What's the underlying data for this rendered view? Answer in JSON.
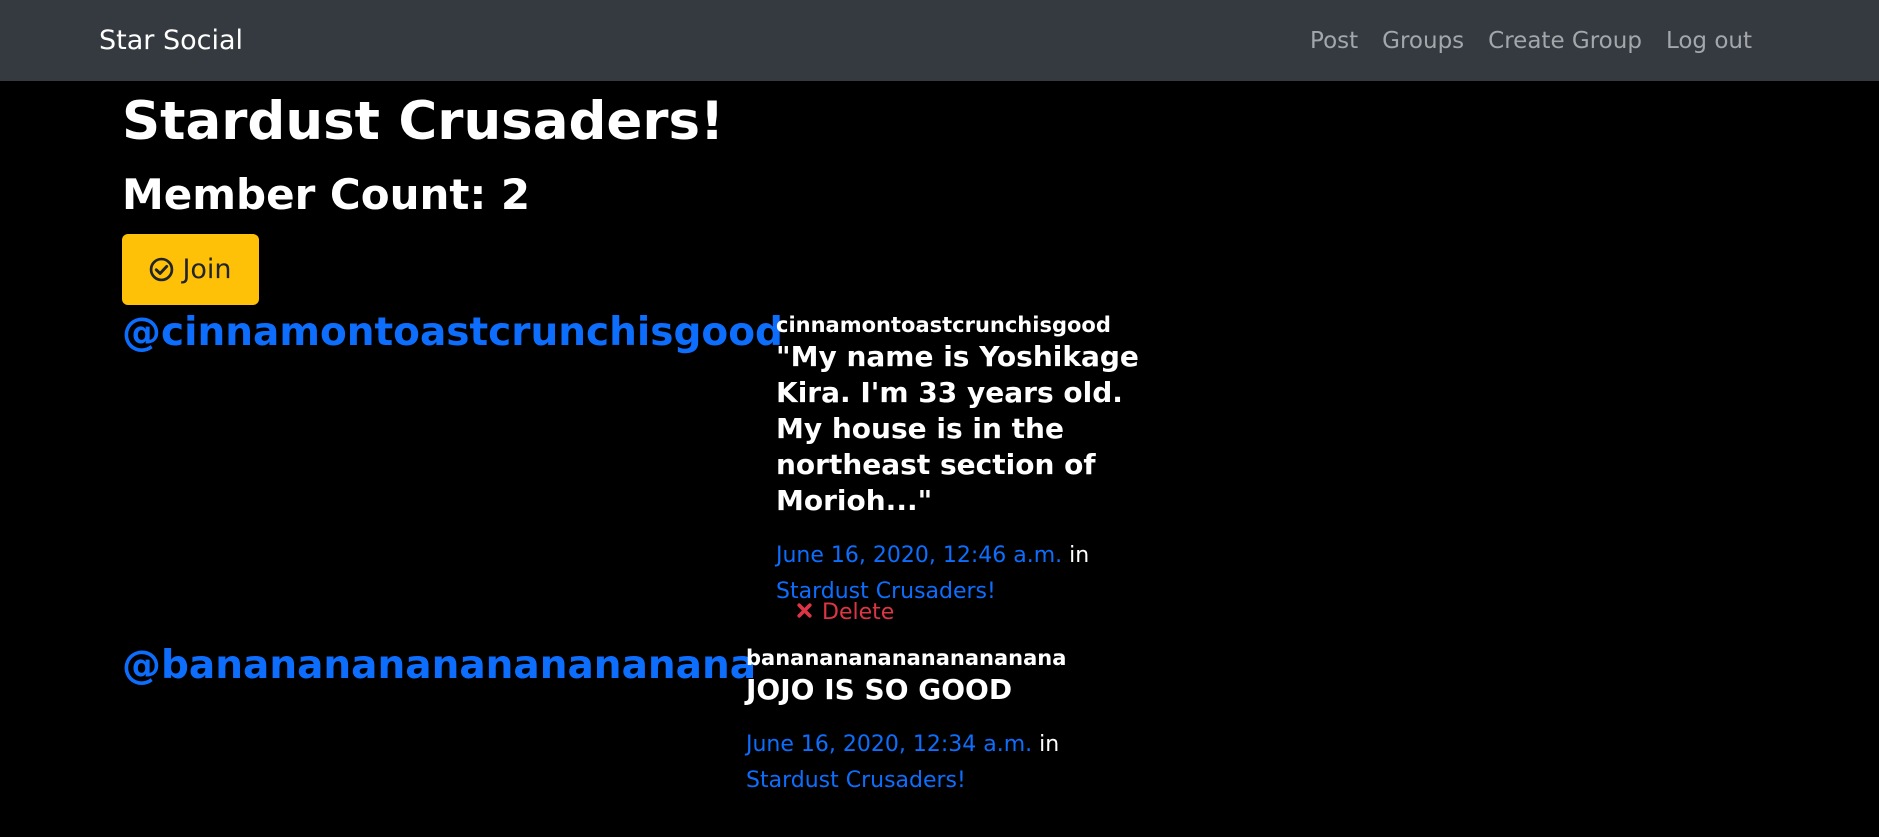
{
  "navbar": {
    "brand": "Star Social",
    "links": [
      "Post",
      "Groups",
      "Create Group",
      "Log out"
    ]
  },
  "group": {
    "title": "Stardust Crusaders!",
    "member_count": "Member Count: 2",
    "join_label": "Join"
  },
  "posts": [
    {
      "user_handle": "@cinnamontoastcrunchisgood",
      "author": "cinnamontoastcrunchisgood",
      "message": "\"My name is Yoshikage Kira. I'm 33 years old. My house is in the northeast section of Morioh...\"",
      "timestamp": "June 16, 2020, 12:46 a.m.",
      "in_word": " in ",
      "group": "Stardust Crusaders!",
      "delete_label": "Delete"
    },
    {
      "user_handle": "@banananananananananana",
      "author": "banananananananananana",
      "message": "JOJO IS SO GOOD",
      "timestamp": "June 16, 2020, 12:34 a.m.",
      "in_word": " in ",
      "group": "Stardust Crusaders!"
    }
  ],
  "colors": {
    "navbar_bg": "#343a40",
    "page_bg": "#000000",
    "link": "#0d6efd",
    "join_button": "#ffc107",
    "danger": "#dc3545"
  },
  "icons": {
    "join": "check-circle-icon",
    "delete": "times-icon"
  }
}
